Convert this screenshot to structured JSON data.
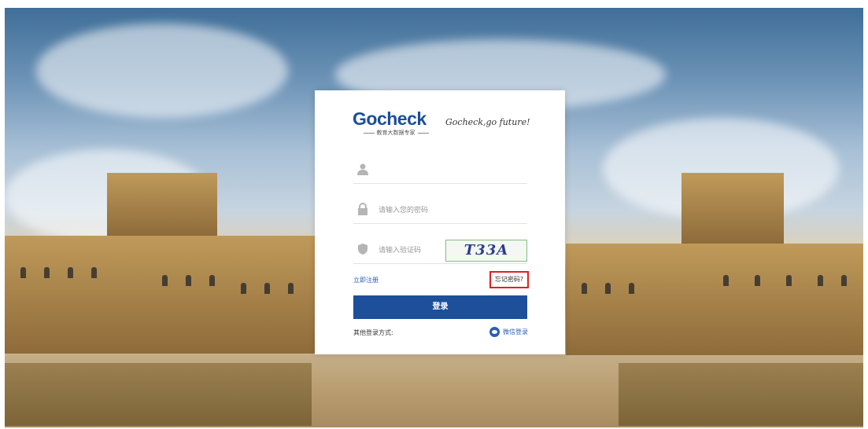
{
  "brand": {
    "logo_text": "Gocheck",
    "logo_subtitle": "教育大数据专家",
    "slogan": "Gocheck,go future!"
  },
  "form": {
    "username": {
      "placeholder": "",
      "value": ""
    },
    "password": {
      "placeholder": "请输入您的密码",
      "value": ""
    },
    "captcha": {
      "placeholder": "请输入验证码",
      "value": "",
      "image_text": "T33A"
    },
    "register_link": "立即注册",
    "forgot_link": "忘记密码?",
    "login_button": "登录",
    "other_methods_label": "其他登录方式:",
    "wechat_login": "微信登录"
  },
  "colors": {
    "primary": "#1d4f9b",
    "link": "#2b5fb3",
    "highlight_border": "#e02020"
  },
  "icons": [
    "user-icon",
    "lock-icon",
    "shield-icon",
    "wechat-icon"
  ]
}
